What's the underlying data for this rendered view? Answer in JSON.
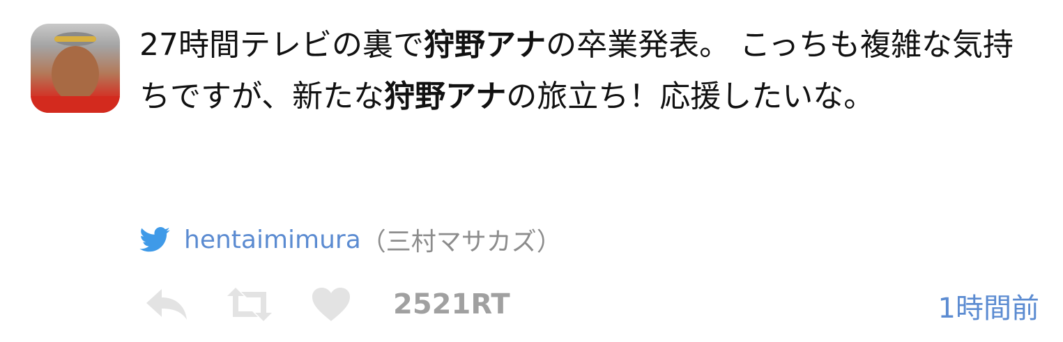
{
  "tweet": {
    "text_segments": [
      {
        "text": "27時間テレビの裏で",
        "bold": false
      },
      {
        "text": "狩野アナ",
        "bold": true
      },
      {
        "text": "の卒業発表。 こっちも複雑な気持ちですが、新たな",
        "bold": false
      },
      {
        "text": "狩野アナ",
        "bold": true
      },
      {
        "text": "の旅立ち！応援したいな。",
        "bold": false
      }
    ],
    "author": {
      "handle": "hentaimimura",
      "display_name": "（三村マサカズ）"
    },
    "retweet_count": "2521RT",
    "timestamp": "1時間前"
  },
  "icons": {
    "avatar": "avatar",
    "bird": "twitter-bird-icon",
    "reply": "reply-icon",
    "retweet": "retweet-icon",
    "like": "heart-icon"
  },
  "colors": {
    "link_blue": "#5b8bd1",
    "icon_gray": "#e3e3e3",
    "count_gray": "#a0a0a0",
    "text": "#111111"
  }
}
